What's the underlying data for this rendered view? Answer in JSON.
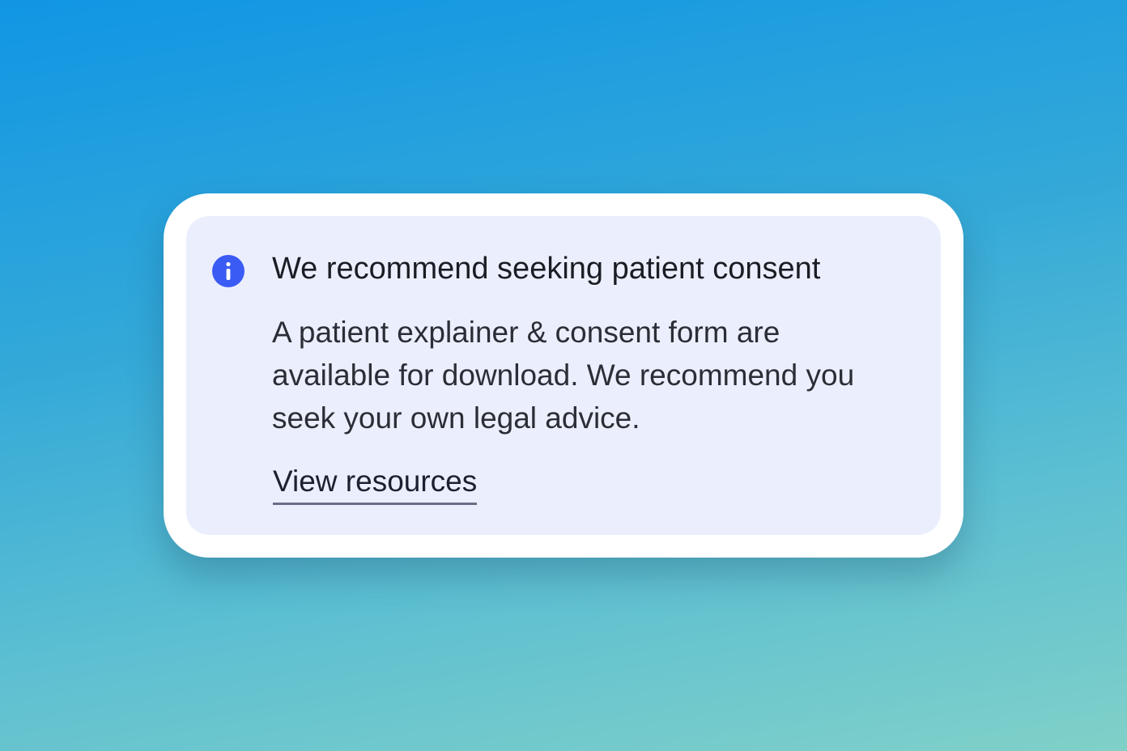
{
  "callout": {
    "icon": "info-icon",
    "accent_color": "#3b5bf5",
    "background_color": "#ebeffd",
    "title": "We recommend seeking patient consent",
    "body": "A patient explainer & consent form are available for download. We recommend you seek your own legal advice.",
    "link_label": "View resources"
  }
}
